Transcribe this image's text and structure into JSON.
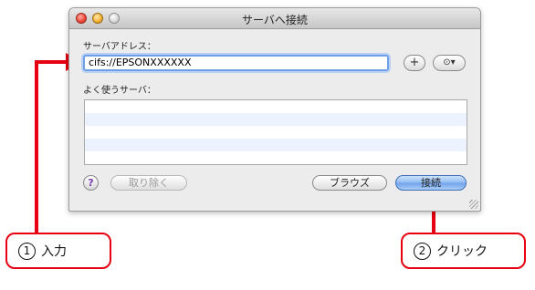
{
  "dialog": {
    "title": "サーバへ接続",
    "address_label": "サーバアドレス：",
    "address_value": "cifs://EPSONXXXXXX",
    "add_button": "+",
    "options_button": "⊙▾",
    "favorites_label": "よく使うサーバ：",
    "help_button": "?",
    "remove_button": "取り除く",
    "browse_button": "ブラウズ",
    "connect_button": "接続"
  },
  "callouts": {
    "step1_number": "1",
    "step1_text": "入力",
    "step2_number": "2",
    "step2_text": "クリック"
  },
  "colors": {
    "annotation": "#e60012",
    "focus_ring": "#6f9fe6",
    "default_button": "#8fbaf2"
  }
}
